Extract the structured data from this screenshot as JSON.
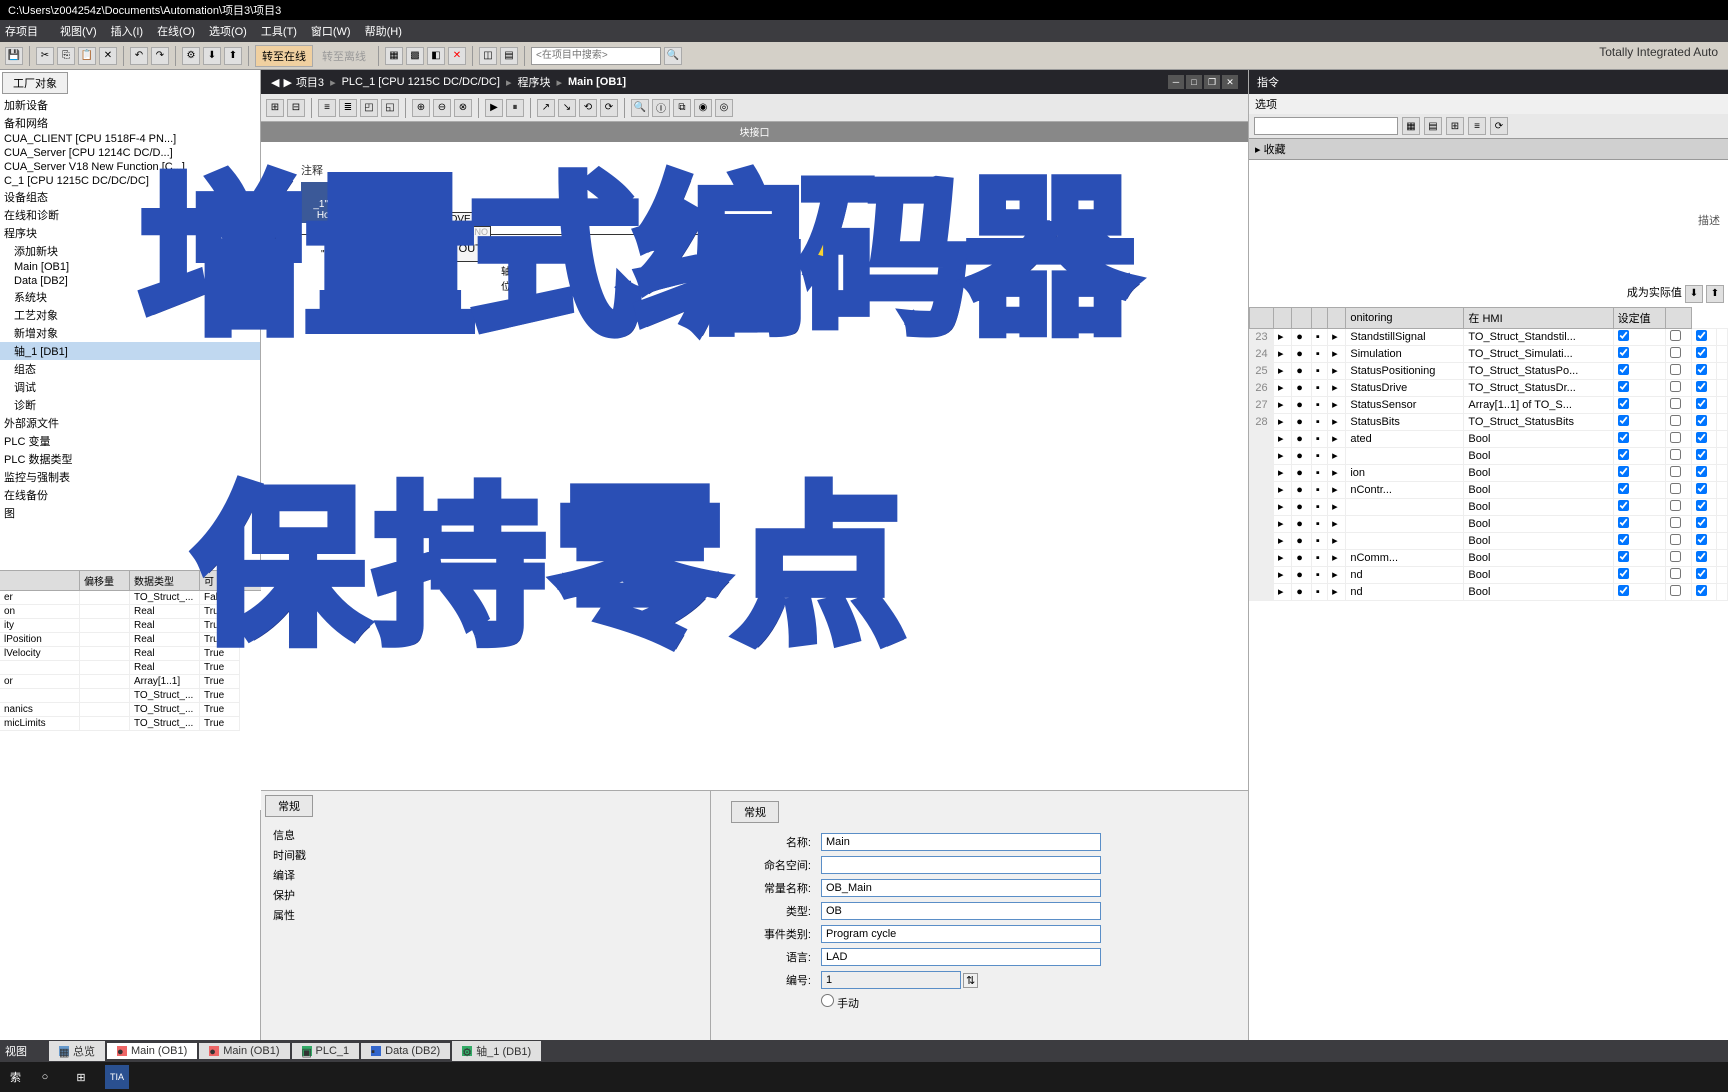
{
  "title": "C:\\Users\\z004254z\\Documents\\Automation\\项目3\\项目3",
  "menu": [
    "项目",
    "视图(V)",
    "插入(I)",
    "在线(O)",
    "选项(O)",
    "工具(T)",
    "窗口(W)",
    "帮助(H)"
  ],
  "toolbar": {
    "save": "存项目",
    "go_online": "转至在线",
    "go_offline": "转至离线",
    "search_placeholder": "<在项目中搜索>"
  },
  "brand": "Totally Integrated Auto",
  "breadcrumb": [
    "项目3",
    "PLC_1 [CPU 1215C DC/DC/DC]",
    "程序块",
    "Main [OB1]"
  ],
  "left": {
    "tab": "工厂对象",
    "tree": [
      "加新设备",
      "备和网络",
      "CUA_CLIENT [CPU 1518F-4 PN...]",
      "CUA_Server [CPU 1214C DC/D...]",
      "CUA_Server V18 New Function [C...]",
      "C_1 [CPU 1215C DC/DC/DC]",
      "设备组态",
      "在线和诊断",
      "程序块",
      "添加新块",
      "Main [OB1]",
      "Data [DB2]",
      "系统块",
      "工艺对象",
      "新增对象",
      "轴_1 [DB1]",
      "组态",
      "调试",
      "诊断",
      "外部源文件",
      "PLC 变量",
      "PLC 数据类型",
      "监控与强制表",
      "在线备份",
      "图"
    ],
    "selected": "轴_1 [DB1]"
  },
  "detail_headers": [
    "",
    "偏移量",
    "数据类型",
    "可"
  ],
  "detail_rows": [
    {
      "name": "er",
      "type": "TO_Struct_...",
      "val": "False"
    },
    {
      "name": "on",
      "type": "Real",
      "val": "True"
    },
    {
      "name": "ity",
      "type": "Real",
      "val": "True"
    },
    {
      "name": "lPosition",
      "type": "Real",
      "val": "True"
    },
    {
      "name": "lVelocity",
      "type": "Real",
      "val": "True"
    },
    {
      "name": "",
      "type": "Real",
      "val": "True"
    },
    {
      "name": "or",
      "type": "Array[1..1]",
      "val": "True"
    },
    {
      "name": "",
      "type": "TO_Struct_...",
      "val": "True"
    },
    {
      "name": "nanics",
      "type": "TO_Struct_...",
      "val": "True"
    },
    {
      "name": "micLimits",
      "type": "TO_Struct_...",
      "val": "True"
    }
  ],
  "ladder": {
    "comment": "注释",
    "tag": "\"轴_1\".StatusBits.\nHomingDone",
    "move": "MOVE",
    "en": "EN",
    "eno": "ENO",
    "in": "IN",
    "out1": "OUT1",
    "in_src": "\"轴_1\".Position",
    "out_dst": "\"Data\".\n保持性轴当前位置"
  },
  "right": {
    "title": "指令",
    "options": "选项",
    "sub": "收藏",
    "desc_col": "描述",
    "action": "成为实际值",
    "headers": [
      "",
      "",
      "",
      "",
      "",
      "onitoring",
      "在 HMI",
      "设定值",
      ""
    ],
    "rows": [
      {
        "n": "23",
        "name": "StandstillSignal",
        "type": "TO_Struct_Standstil..."
      },
      {
        "n": "24",
        "name": "Simulation",
        "type": "TO_Struct_Simulati..."
      },
      {
        "n": "25",
        "name": "StatusPositioning",
        "type": "TO_Struct_StatusPo..."
      },
      {
        "n": "26",
        "name": "StatusDrive",
        "type": "TO_Struct_StatusDr..."
      },
      {
        "n": "27",
        "name": "StatusSensor",
        "type": "Array[1..1] of TO_S..."
      },
      {
        "n": "28",
        "name": "StatusBits",
        "type": "TO_Struct_StatusBits"
      },
      {
        "n": "",
        "name": "ated",
        "type": "Bool"
      },
      {
        "n": "",
        "name": "",
        "type": "Bool"
      },
      {
        "n": "",
        "name": "ion",
        "type": "Bool"
      },
      {
        "n": "",
        "name": "nContr...",
        "type": "Bool"
      },
      {
        "n": "",
        "name": "",
        "type": "Bool"
      },
      {
        "n": "",
        "name": "",
        "type": "Bool"
      },
      {
        "n": "",
        "name": "",
        "type": "Bool"
      },
      {
        "n": "",
        "name": "nComm...",
        "type": "Bool"
      },
      {
        "n": "",
        "name": "nd",
        "type": "Bool"
      },
      {
        "n": "",
        "name": "nd",
        "type": "Bool"
      }
    ]
  },
  "props": {
    "tab": "常规",
    "tree": [
      "信息",
      "时间戳",
      "编译",
      "保护",
      "属性"
    ],
    "form": {
      "name_l": "名称:",
      "name_v": "Main",
      "ns_l": "命名空间:",
      "ns_v": "",
      "const_l": "常量名称:",
      "const_v": "OB_Main",
      "type_l": "类型:",
      "type_v": "OB",
      "event_l": "事件类别:",
      "event_v": "Program cycle",
      "lang_l": "语言:",
      "lang_v": "LAD",
      "num_l": "编号:",
      "num_v": "1",
      "manual": "手动"
    }
  },
  "footer": {
    "view": "视图",
    "tabs": [
      "总览",
      "Main (OB1)",
      "Main (OB1)",
      "PLC_1",
      "Data (DB2)",
      "轴_1 (DB1)"
    ]
  },
  "taskbar": {
    "search": "索",
    "tia": "TIA"
  },
  "overlay1": "增量式编码器",
  "overlay2": "保持零点"
}
